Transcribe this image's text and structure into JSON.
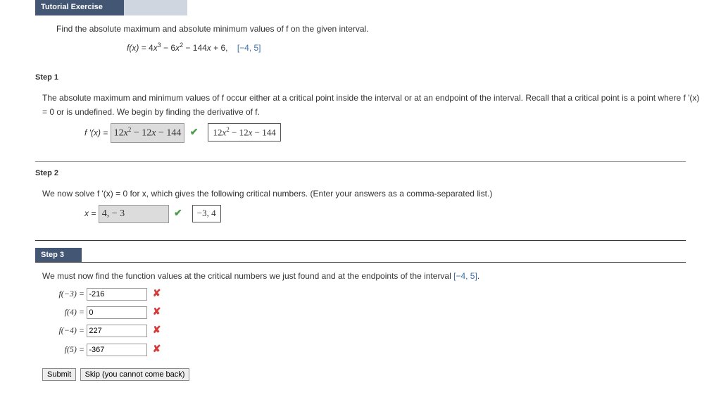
{
  "header": {
    "title": "Tutorial Exercise"
  },
  "problem": {
    "prompt": "Find the absolute maximum and absolute minimum values of f on the given interval.",
    "formula_lhs": "f(x) = ",
    "formula_rhs_plain": "4x³ − 6x² − 144x + 6,",
    "interval": "[−4, 5]"
  },
  "step1": {
    "title": "Step 1",
    "text": "The absolute maximum and minimum values of f occur either at a critical point inside the interval or at an endpoint of the interval. Recall that a critical point is a point where f '(x) = 0 or is undefined. We begin by finding the derivative of f.",
    "deriv_label": "f '(x) = ",
    "deriv_value": "12x² − 12x − 144",
    "deriv_confirm": "12x² − 12x − 144"
  },
  "step2": {
    "title": "Step 2",
    "text": "We now solve f '(x) = 0 for x, which gives the following critical numbers. (Enter your answers as a comma-separated list.)",
    "x_label": "x = ",
    "x_value": "4,  − 3",
    "x_confirm": "−3, 4"
  },
  "step3": {
    "title": "Step 3",
    "text_pre": "We must now find the function values at the critical numbers we just found and at the endpoints of the interval ",
    "interval": "[−4, 5]",
    "text_post": ".",
    "rows": [
      {
        "label": "f(−3) = ",
        "value": "-216"
      },
      {
        "label": "f(4) = ",
        "value": "0"
      },
      {
        "label": "f(−4) = ",
        "value": "227"
      },
      {
        "label": "f(5) = ",
        "value": "-367"
      }
    ]
  },
  "buttons": {
    "submit": "Submit",
    "skip": "Skip (you cannot come back)"
  }
}
